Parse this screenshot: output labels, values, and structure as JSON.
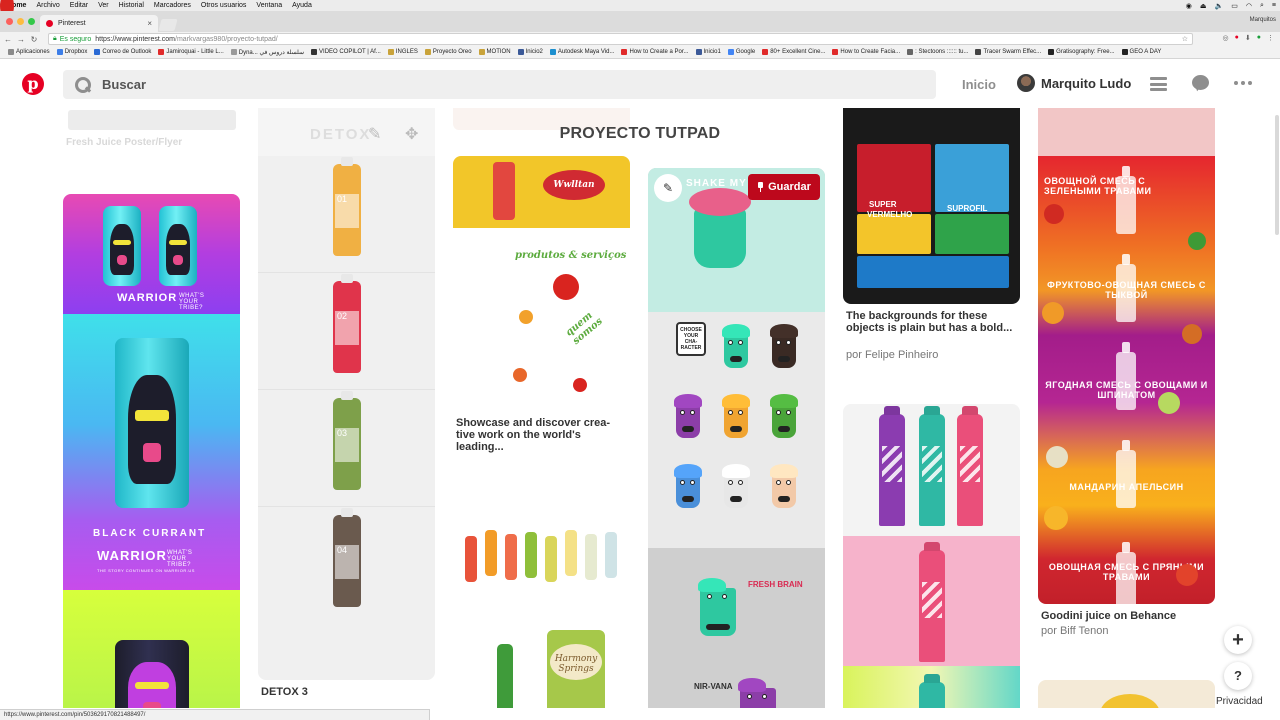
{
  "os_menubar": {
    "app": "Chrome",
    "items": [
      "Archivo",
      "Editar",
      "Ver",
      "Historial",
      "Marcadores",
      "Otros usuarios",
      "Ventana",
      "Ayuda"
    ]
  },
  "browser": {
    "tab_title": "Pinterest",
    "profile": "Marquitos",
    "secure_label": "Es seguro",
    "url_host": "https://www.pinterest.com",
    "url_path": "/markvargas980/proyecto-tutpad/",
    "bookmarks": [
      "Aplicaciones",
      "Dropbox",
      "Correo de Outlook",
      "Jamiroquai - Little L...",
      "Dyna... سلسلة دروس في",
      "VIDEO COPILOT | Af...",
      "INGLES",
      "Proyecto Oreo",
      "MOTION",
      "Inicio2",
      "Autodesk Maya Vid...",
      "How to Create a Por...",
      "Inicio1",
      "Google",
      "80+ Excellent Cine...",
      "How to Create Facia...",
      ": Stectoons :::::: tu...",
      "Tracer Swarm Effec...",
      "Gratisography: Free...",
      "GEO A DAY"
    ],
    "status_url": "https://www.pinterest.com/pin/503629170821488497/"
  },
  "header": {
    "search_placeholder": "Buscar",
    "home_label": "Inicio",
    "username": "Marquito Ludo"
  },
  "board": {
    "title": "PROYECTO TUTPAD"
  },
  "pins": {
    "faded_caption": "Fresh Juice Poster/Flyer",
    "detox_overlay": "DETOX",
    "detox_caption": "DETOX 3",
    "detox_labels": [
      "01",
      "02",
      "03",
      "04"
    ],
    "warrior_brand": "WARRIOR",
    "warrior_tagline": "WHAT'S YOUR TRIBE?",
    "warrior_flavor": "BLACK CURRANT",
    "warrior_sub": "THE STORY CONTINUES ON WARRIOR.US",
    "showcase_logo": "Wwlltan",
    "showcase_caption": "Showcase and discover crea-tive work on the world's leading...",
    "showcase_script_1": "produtos & serviços",
    "showcase_script_2": "quem somos",
    "harmony_label": "Harmony Springs",
    "shake_title": "- SHAKE MY HEAD! -",
    "choose_text": "CHOOSE YOUR CHA-RACTER",
    "fresh_brain": "FRESH BRAIN",
    "nirvana": "NIR-VANA",
    "save_label": "Guardar",
    "soda_caption": "The backgrounds for these objects is plain but has a bold...",
    "soda_author": "por Felipe Pinheiro",
    "soda_text_1": "SUPER",
    "soda_text_2": "VERMELHO",
    "soda_text_3": "SUPROFIL",
    "goodini_texts": [
      "ОВОЩНОЙ СМЕСЬ С ЗЕЛЕНЫМИ ТРАВАМИ",
      "ФРУКТОВО-ОВОЩНАЯ СМЕСЬ С ТЫКВОЙ",
      "ЯГОДНАЯ СМЕСЬ С ОВОЩАМИ И ШПИНАТОМ",
      "МАНДАРИН АПЕЛЬСИН",
      "ОВОЩНАЯ СМЕСЬ С ПРЯНЫМИ ТРАВАМИ"
    ],
    "goodini_caption": "Goodini juice on Behance",
    "goodini_author": "por Biff Tenon"
  },
  "floating": {
    "plus": "+",
    "help": "?",
    "privacy": "Privacidad"
  },
  "colors": {
    "pinterest_red": "#e60023",
    "save_red": "#bd081c"
  }
}
